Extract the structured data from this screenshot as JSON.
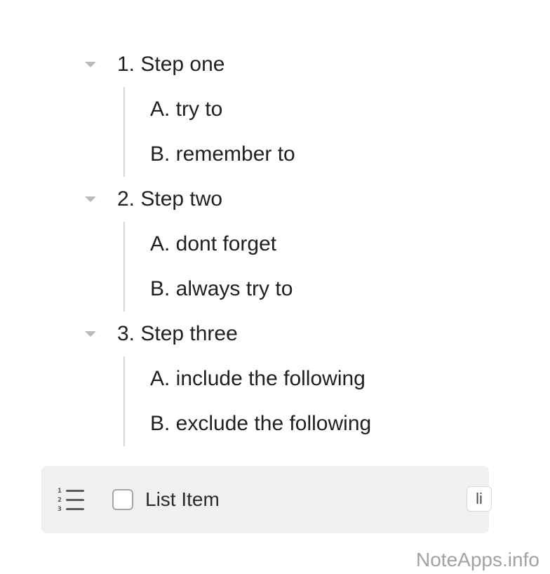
{
  "outline": {
    "steps": [
      {
        "label": "1. Step one",
        "subs": [
          "A. try to",
          "B. remember to"
        ]
      },
      {
        "label": "2. Step two",
        "subs": [
          "A. dont forget",
          "B. always try to"
        ]
      },
      {
        "label": "3. Step three",
        "subs": [
          "A. include the following",
          "B. exclude the following"
        ]
      }
    ]
  },
  "toolbar": {
    "icon": "numbered-list-icon",
    "item_label": "List Item",
    "badge": "li"
  },
  "watermark": "NoteApps.info",
  "colors": {
    "text": "#1f1f24",
    "caret": "#b9b9c0",
    "guide_line": "#d6d6da",
    "toolbar_bg": "#f0f0f1",
    "watermark": "#a2a2a6"
  }
}
